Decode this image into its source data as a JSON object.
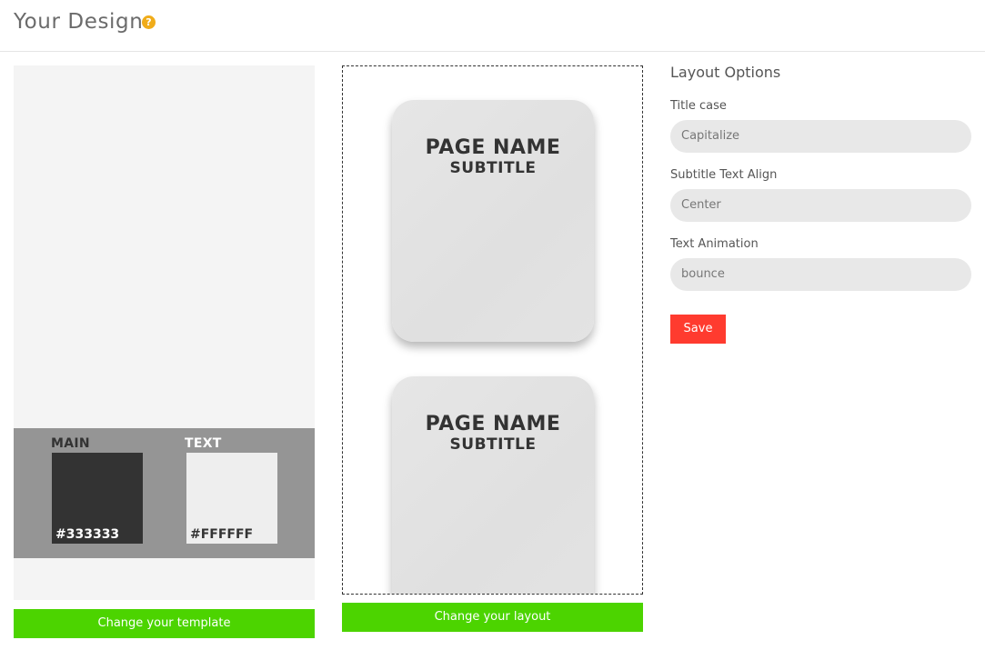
{
  "header": {
    "title": "Your Design",
    "help_icon": "question-circle-icon",
    "help_glyph": "?"
  },
  "template": {
    "main_label": "MAIN",
    "main_color": "#333333",
    "text_label": "TEXT",
    "text_color": "#FFFFFF",
    "change_button": "Change your template"
  },
  "layout": {
    "cards": [
      {
        "title": "PAGE NAME",
        "subtitle": "SUBTITLE"
      },
      {
        "title": "PAGE NAME",
        "subtitle": "SUBTITLE"
      }
    ],
    "change_button": "Change your layout"
  },
  "options": {
    "title": "Layout Options",
    "title_case_label": "Title case",
    "title_case_value": "Capitalize",
    "subtitle_align_label": "Subtitle Text Align",
    "subtitle_align_value": "Center",
    "text_animation_label": "Text Animation",
    "text_animation_value": "bounce",
    "save_label": "Save"
  },
  "colors": {
    "accent_green": "#4cd400",
    "save_red": "#ff3b2f",
    "help_orange": "#f0ac1a"
  }
}
